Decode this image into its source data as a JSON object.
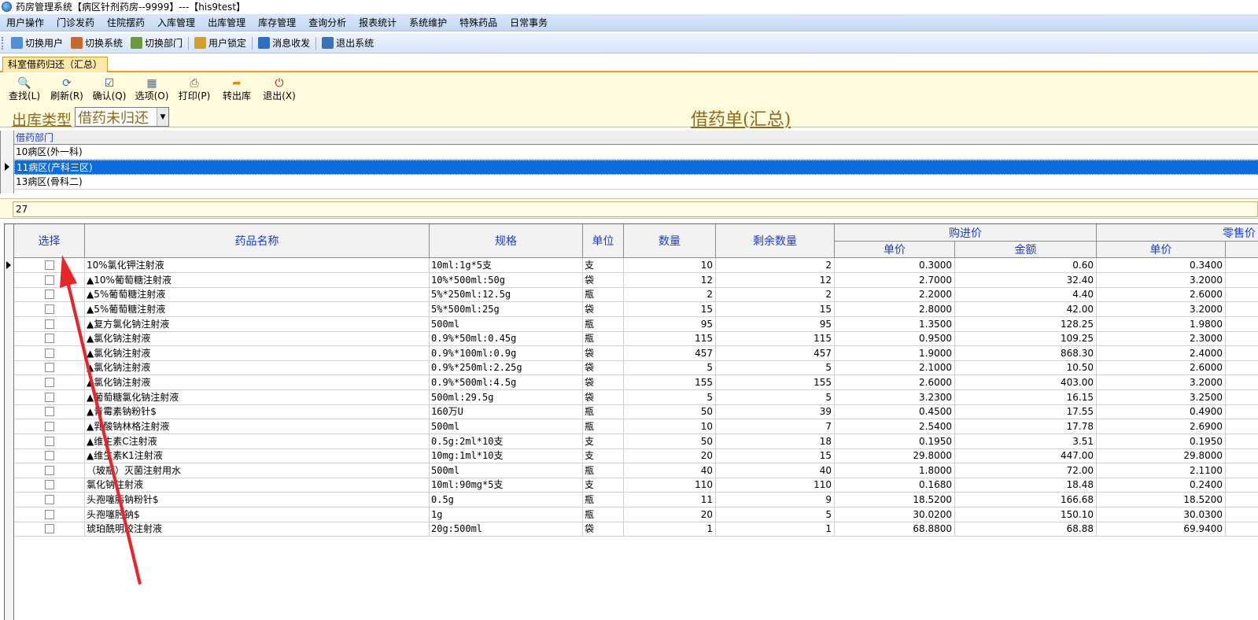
{
  "window": {
    "title": "药房管理系统【病区针剂药房--9999】---【his9test】"
  },
  "menu": [
    "用户操作",
    "门诊发药",
    "住院摆药",
    "入库管理",
    "出库管理",
    "库存管理",
    "查询分析",
    "报表统计",
    "系统维护",
    "特殊药品",
    "日常事务"
  ],
  "toolbar": [
    {
      "label": "切换用户",
      "icon": "users-icon"
    },
    {
      "label": "切换系统",
      "icon": "switch-system-icon"
    },
    {
      "label": "切换部门",
      "icon": "switch-dept-icon"
    },
    {
      "label": "用户锁定",
      "icon": "lock-user-icon"
    },
    {
      "label": "消息收发",
      "icon": "message-icon"
    },
    {
      "label": "退出系统",
      "icon": "exit-icon"
    }
  ],
  "doc_tab": "科室借药归还（汇总）",
  "actions": [
    {
      "label": "查找(L)",
      "icon": "search-icon"
    },
    {
      "label": "刷新(R)",
      "icon": "refresh-icon"
    },
    {
      "label": "确认(Q)",
      "icon": "confirm-icon"
    },
    {
      "label": "选项(O)",
      "icon": "options-icon"
    },
    {
      "label": "打印(P)",
      "icon": "print-icon"
    },
    {
      "label": "转出库",
      "icon": "transfer-icon"
    },
    {
      "label": "退出(X)",
      "icon": "exit-icon"
    }
  ],
  "filter": {
    "label": "出库类型",
    "value": "借药未归还"
  },
  "doc_title": "借药单(汇总)",
  "dept": {
    "header": "借药部门",
    "rows": [
      "10病区(外一科)",
      "11病区(产科三区)",
      "13病区(骨科二)"
    ],
    "selected_index": 1
  },
  "count": "27",
  "table": {
    "headers": {
      "select": "选择",
      "name": "药品名称",
      "spec": "规格",
      "unit": "单位",
      "qty": "数量",
      "remain": "剩余数量",
      "purchase": "购进价",
      "purchase_price": "单价",
      "purchase_amount": "金额",
      "retail": "零售价",
      "retail_price": "单价"
    },
    "rows": [
      [
        "10%氯化钾注射液",
        "10ml:1g*5支",
        "支",
        "10",
        "2",
        "0.3000",
        "0.60",
        "0.3400"
      ],
      [
        "▲10%葡萄糖注射液",
        "10%*500ml:50g",
        "袋",
        "12",
        "12",
        "2.7000",
        "32.40",
        "3.2000"
      ],
      [
        "▲5%葡萄糖注射液",
        "5%*250ml:12.5g",
        "瓶",
        "2",
        "2",
        "2.2000",
        "4.40",
        "2.6000"
      ],
      [
        "▲5%葡萄糖注射液",
        "5%*500ml:25g",
        "袋",
        "15",
        "15",
        "2.8000",
        "42.00",
        "3.2000"
      ],
      [
        "▲复方氯化钠注射液",
        "500ml",
        "瓶",
        "95",
        "95",
        "1.3500",
        "128.25",
        "1.9800"
      ],
      [
        "▲氯化钠注射液",
        "0.9%*50ml:0.45g",
        "瓶",
        "115",
        "115",
        "0.9500",
        "109.25",
        "2.3000"
      ],
      [
        "▲氯化钠注射液",
        "0.9%*100ml:0.9g",
        "袋",
        "457",
        "457",
        "1.9000",
        "868.30",
        "2.4000"
      ],
      [
        "▲氯化钠注射液",
        "0.9%*250ml:2.25g",
        "袋",
        "5",
        "5",
        "2.1000",
        "10.50",
        "2.6000"
      ],
      [
        "▲氯化钠注射液",
        "0.9%*500ml:4.5g",
        "袋",
        "155",
        "155",
        "2.6000",
        "403.00",
        "3.2000"
      ],
      [
        "▲葡萄糖氯化钠注射液",
        "500ml:29.5g",
        "袋",
        "5",
        "5",
        "3.2300",
        "16.15",
        "3.2500"
      ],
      [
        "▲青霉素钠粉针$",
        "160万U",
        "瓶",
        "50",
        "39",
        "0.4500",
        "17.55",
        "0.4900"
      ],
      [
        "▲乳酸钠林格注射液",
        "500ml",
        "瓶",
        "10",
        "7",
        "2.5400",
        "17.78",
        "2.6900"
      ],
      [
        "▲维生素C注射液",
        "0.5g:2ml*10支",
        "支",
        "50",
        "18",
        "0.1950",
        "3.51",
        "0.1950"
      ],
      [
        "▲维生素K1注射液",
        "10mg:1ml*10支",
        "支",
        "20",
        "15",
        "29.8000",
        "447.00",
        "29.8000"
      ],
      [
        "（玻瓶）灭菌注射用水",
        "500ml",
        "瓶",
        "40",
        "40",
        "1.8000",
        "72.00",
        "2.1100"
      ],
      [
        "氯化钠注射液",
        "10ml:90mg*5支",
        "支",
        "110",
        "110",
        "0.1680",
        "18.48",
        "0.2400"
      ],
      [
        "头孢噻肟钠粉针$",
        "0.5g",
        "瓶",
        "11",
        "9",
        "18.5200",
        "166.68",
        "18.5200"
      ],
      [
        "头孢噻肟钠$",
        "1g",
        "瓶",
        "20",
        "5",
        "30.0200",
        "150.10",
        "30.0300"
      ],
      [
        "琥珀酰明胶注射液",
        "20g:500ml",
        "袋",
        "1",
        "1",
        "68.8800",
        "68.88",
        "69.9400"
      ]
    ]
  },
  "colors": {
    "accent": "#0a6ddb",
    "header_text": "#1a3fc4",
    "annotation": "#e8262a",
    "panel": "#fffbdc"
  }
}
